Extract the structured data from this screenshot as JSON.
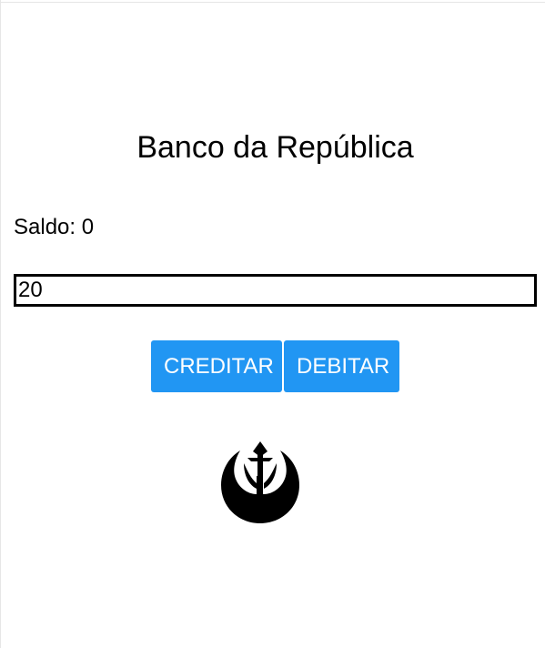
{
  "app": {
    "title": "Banco da República"
  },
  "balance": {
    "text": "Saldo: 0"
  },
  "amount_input": {
    "value": "20"
  },
  "actions": {
    "credit_label": "CREDITAR",
    "debit_label": "DEBITAR"
  },
  "logo": {
    "icon": "rebel-alliance-icon"
  },
  "colors": {
    "button_bg": "#2196f3",
    "button_text": "#ffffff",
    "text": "#000000",
    "background": "#ffffff"
  }
}
